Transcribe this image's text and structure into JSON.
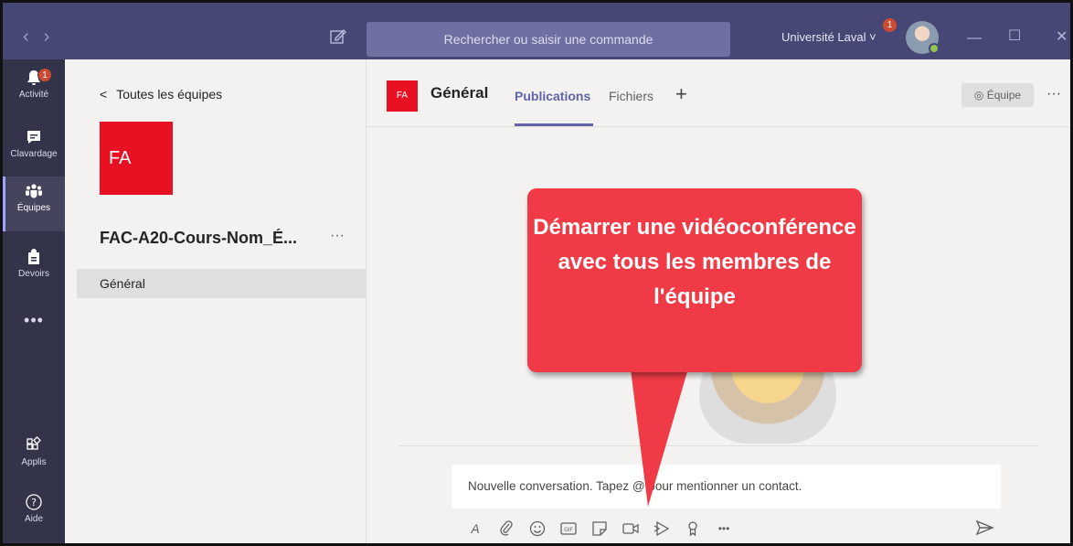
{
  "titlebar": {
    "search_placeholder": "Rechercher ou saisir une commande",
    "org_name": "Université Laval",
    "org_notification_count": "1"
  },
  "rail": {
    "items": [
      {
        "label": "Activité",
        "icon": "bell-icon",
        "badge": "1"
      },
      {
        "label": "Clavardage",
        "icon": "chat-icon"
      },
      {
        "label": "Équipes",
        "icon": "teams-icon"
      },
      {
        "label": "Devoirs",
        "icon": "backpack-icon"
      },
      {
        "label": "Applis",
        "icon": "apps-icon"
      },
      {
        "label": "Aide",
        "icon": "help-icon"
      }
    ],
    "more": "•••"
  },
  "team_panel": {
    "back_label": "Toutes les équipes",
    "tile_initials": "FA",
    "team_name": "FAC-A20-Cours-Nom_É...",
    "more": "···",
    "channels": [
      "Général"
    ]
  },
  "main": {
    "channel_initials": "FA",
    "channel_title": "Général",
    "tabs": [
      {
        "label": "Publications",
        "active": true
      },
      {
        "label": "Fichiers",
        "active": false
      }
    ],
    "add_tab": "+",
    "team_button": "◎ Équipe",
    "more": "···",
    "composer_placeholder": "Nouvelle conversation. Tapez @ pour mentionner un contact.",
    "toolbar": [
      "format-icon",
      "attach-icon",
      "emoji-icon",
      "gif-icon",
      "sticker-icon",
      "meet-now-icon",
      "stream-icon",
      "praise-icon",
      "more-icon"
    ],
    "toolbar_more": "•••"
  },
  "callout": {
    "text": "Démarrer une vidéoconférence avec tous les membres de l'équipe"
  },
  "colors": {
    "titlebar": "#464775",
    "rail": "#33344a",
    "accent": "#6264a7",
    "team_tile": "#e81123",
    "callout": "#f03b46"
  }
}
